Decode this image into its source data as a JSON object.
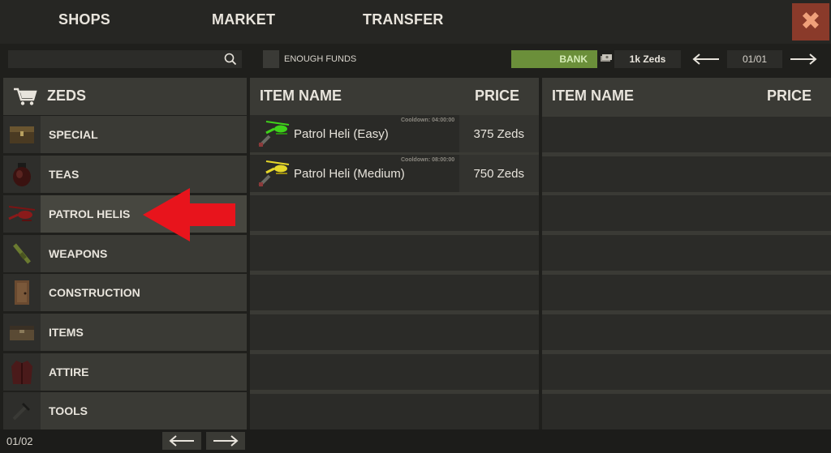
{
  "tabs": [
    {
      "label": "SHOPS"
    },
    {
      "label": "MARKET"
    },
    {
      "label": "TRANSFER"
    }
  ],
  "toolbar": {
    "search_placeholder": "",
    "enough_funds_label": "ENOUGH FUNDS",
    "bank_label": "BANK",
    "balance": "1k Zeds",
    "page_indicator": "01/01"
  },
  "sidebar": {
    "title": "ZEDS",
    "categories": [
      {
        "label": "SPECIAL"
      },
      {
        "label": "TEAS"
      },
      {
        "label": "PATROL HELIS"
      },
      {
        "label": "WEAPONS"
      },
      {
        "label": "CONSTRUCTION"
      },
      {
        "label": "ITEMS"
      },
      {
        "label": "ATTIRE"
      },
      {
        "label": "TOOLS"
      }
    ],
    "active_category": "PATROL HELIS",
    "page_indicator": "01/02"
  },
  "shop_panel": {
    "col_name": "ITEM NAME",
    "col_price": "PRICE",
    "items": [
      {
        "name": "Patrol Heli (Easy)",
        "cooldown": "Cooldown: 04:00:00",
        "price": "375 Zeds",
        "icon_color": "#3fd21a"
      },
      {
        "name": "Patrol Heli (Medium)",
        "cooldown": "Cooldown: 08:00:00",
        "price": "750 Zeds",
        "icon_color": "#e6d82a"
      }
    ]
  },
  "cart_panel": {
    "col_name": "ITEM NAME",
    "col_price": "PRICE",
    "items": []
  },
  "colors": {
    "accent_bank": "#6b8f3a",
    "close_button": "#8a3a2a",
    "callout_arrow": "#e8141c"
  }
}
